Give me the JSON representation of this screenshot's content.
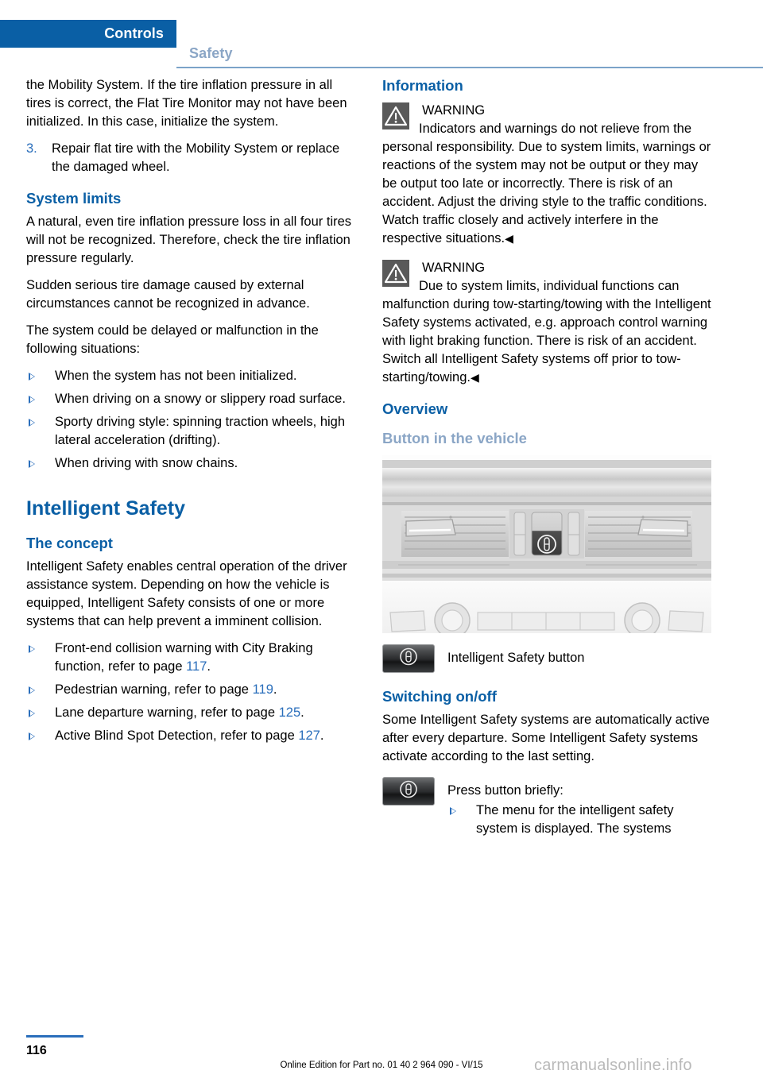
{
  "header": {
    "active_tab": "Controls",
    "inactive_tab": "Safety",
    "active_bg": "#0a5fa5",
    "inactive_color": "#8ba6c6"
  },
  "left_column": {
    "continued_paragraph": "the Mobility System. If the tire inflation pressure in all tires is correct, the Flat Tire Monitor may not have been initialized. In this case, initialize the system.",
    "numbered_items": [
      {
        "num": "3.",
        "text": "Repair flat tire with the Mobility System or replace the damaged wheel."
      }
    ],
    "system_limits": {
      "heading": "System limits",
      "paragraphs": [
        "A natural, even tire inflation pressure loss in all four tires will not be recognized. Therefore, check the tire inflation pressure regularly.",
        "Sudden serious tire damage caused by external circumstances cannot be recognized in advance.",
        "The system could be delayed or malfunction in the following situations:"
      ],
      "bullets": [
        "When the system has not been initialized.",
        "When driving on a snowy or slippery road surface.",
        "Sporty driving style: spinning traction wheels, high lateral acceleration (drifting).",
        "When driving with snow chains."
      ]
    },
    "intelligent_safety": {
      "title": "Intelligent Safety",
      "concept_heading": "The concept",
      "concept_paragraph": "Intelligent Safety enables central operation of the driver assistance system. Depending on how the vehicle is equipped, Intelligent Safety consists of one or more systems that can help prevent a imminent collision.",
      "bullets": [
        {
          "text_before": "Front-end collision warning with City Braking function, refer to page ",
          "page_ref": "117",
          "text_after": "."
        },
        {
          "text_before": "Pedestrian warning, refer to page ",
          "page_ref": "119",
          "text_after": "."
        },
        {
          "text_before": "Lane departure warning, refer to page ",
          "page_ref": "125",
          "text_after": "."
        },
        {
          "text_before": "Active Blind Spot Detection, refer to page ",
          "page_ref": "127",
          "text_after": "."
        }
      ]
    }
  },
  "right_column": {
    "information_heading": "Information",
    "warnings": [
      {
        "icon": "warning-triangle-icon",
        "title": "WARNING",
        "text": "Indicators and warnings do not relieve from the personal responsibility. Due to system limits, warnings or reactions of the system may not be output or they may be output too late or incorrectly. There is risk of an accident. Adjust the driving style to the traffic conditions. Watch traffic closely and actively interfere in the respective situations.",
        "endmark": "◀"
      },
      {
        "icon": "warning-triangle-icon",
        "title": "WARNING",
        "text": "Due to system limits, individual functions can malfunction during tow-starting/towing with the Intelligent Safety systems activated, e.g. approach control warning with light braking function. There is risk of an accident. Switch all Intelligent Safety systems off prior to tow-starting/towing.",
        "endmark": "◀"
      }
    ],
    "overview_heading": "Overview",
    "button_in_vehicle_heading": "Button in the vehicle",
    "figure_alt": "Vehicle dashboard center console with air vents and Intelligent Safety button",
    "button_caption": "Intelligent Safety button",
    "switching_heading": "Switching on/off",
    "switching_paragraph": "Some Intelligent Safety systems are automatically active after every departure. Some Intelligent Safety systems activate according to the last setting.",
    "press_button_label": "Press button briefly:",
    "press_button_bullets": [
      "The menu for the intelligent safety system is displayed. The systems"
    ]
  },
  "footer": {
    "page_number": "116",
    "note": "Online Edition for Part no. 01 40 2 964 090 - VI/15",
    "watermark": "carmanualsonline.info"
  },
  "colors": {
    "brand_blue": "#0a5fa5",
    "link_blue": "#2a6ebb",
    "muted_blue": "#8ba6c6",
    "warning_icon_bg": "#595959"
  }
}
